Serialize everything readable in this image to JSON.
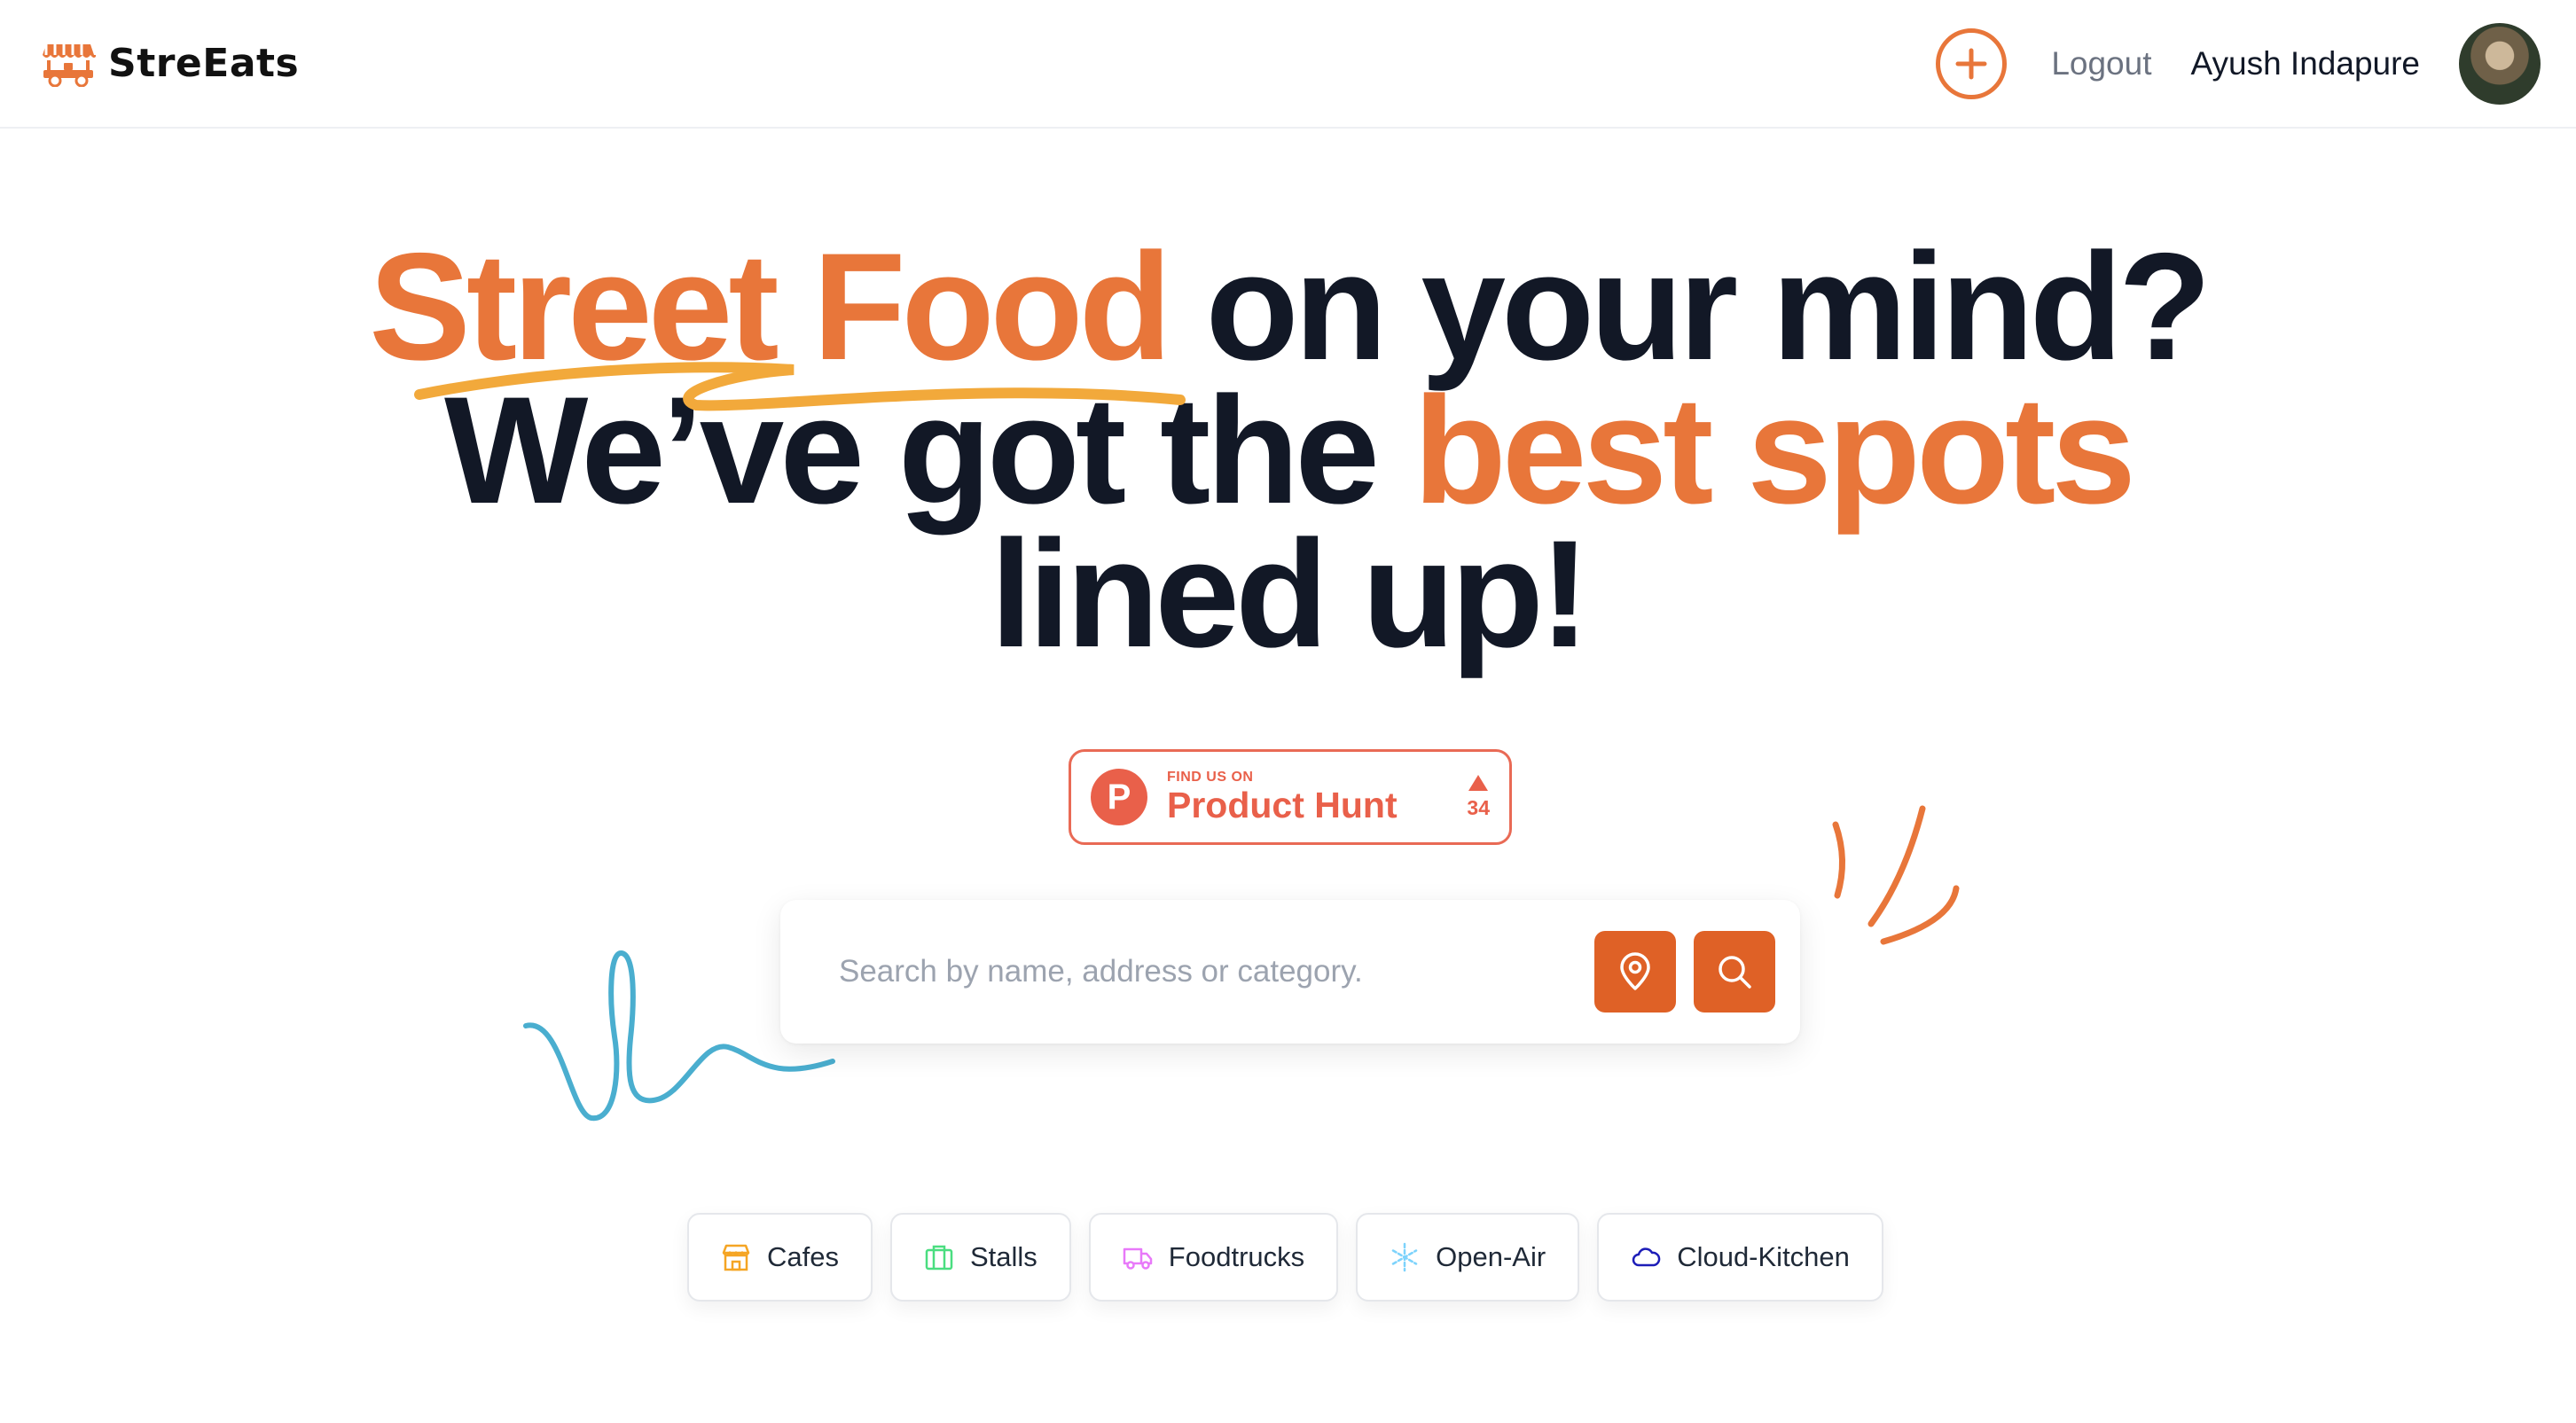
{
  "header": {
    "brand_name": "StreEats",
    "logout_label": "Logout",
    "user_name": "Ayush Indapure"
  },
  "hero": {
    "line1_accent": "Street Food",
    "line1_rest": "on your mind?",
    "line2_start": "We’ve got the",
    "line2_accent": "best spots",
    "line3": "lined up!"
  },
  "product_hunt": {
    "small_label": "FIND US ON",
    "big_label": "Product Hunt",
    "logo_letter": "P",
    "votes": "34"
  },
  "search": {
    "placeholder": "Search by name, address or category."
  },
  "categories": [
    {
      "label": "Cafes",
      "icon": "store-icon",
      "color": "#f5a524"
    },
    {
      "label": "Stalls",
      "icon": "stall-icon",
      "color": "#4ade80"
    },
    {
      "label": "Foodtrucks",
      "icon": "truck-icon",
      "color": "#e879f9"
    },
    {
      "label": "Open-Air",
      "icon": "snowflake-icon",
      "color": "#7dd3fc"
    },
    {
      "label": "Cloud-Kitchen",
      "icon": "cloud-icon",
      "color": "#1d1db8"
    }
  ],
  "colors": {
    "accent": "#e8763a",
    "button": "#df6126",
    "product_hunt": "#e9604a",
    "squiggle_blue": "#4aaecf",
    "highlight_yellow": "#f2a93b"
  }
}
